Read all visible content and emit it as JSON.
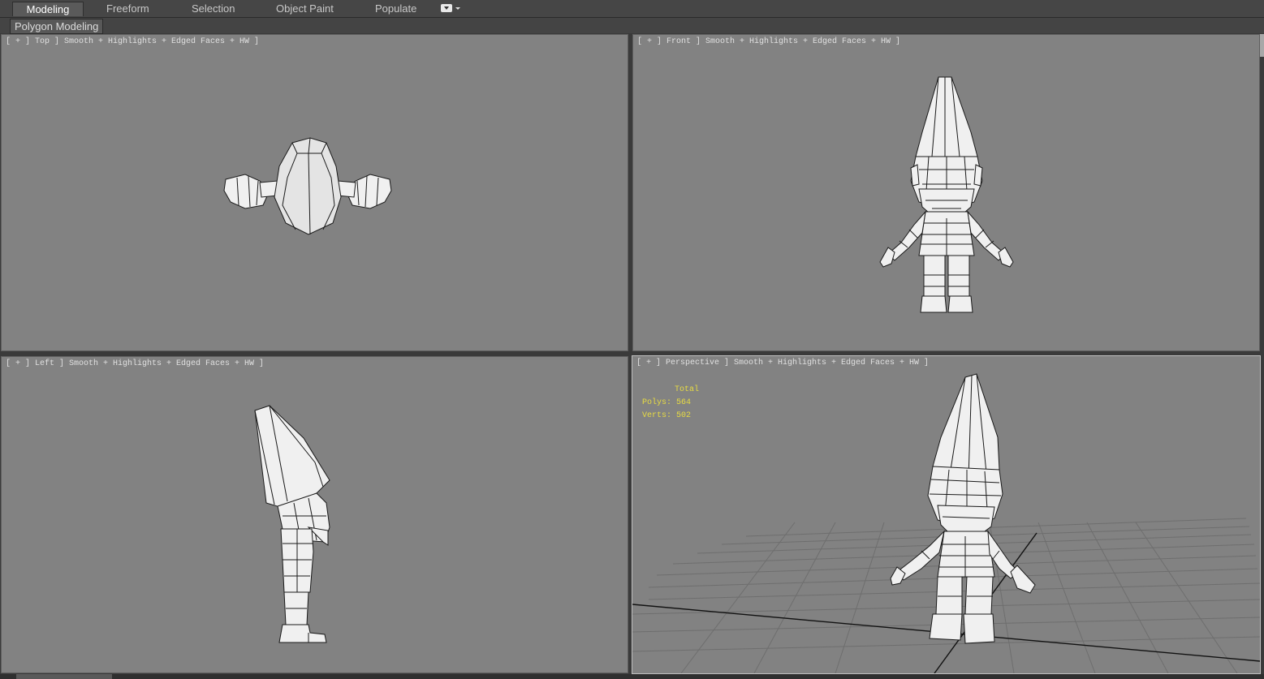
{
  "ribbon": {
    "tabs": [
      {
        "label": "Modeling",
        "active": true
      },
      {
        "label": "Freeform"
      },
      {
        "label": "Selection"
      },
      {
        "label": "Object Paint"
      },
      {
        "label": "Populate"
      }
    ],
    "menu_icon": "dropdown-icon",
    "panel_label": "Polygon Modeling"
  },
  "viewports": {
    "top": {
      "label": "[ + ] Top ] Smooth + Highlights + Edged Faces + HW ]"
    },
    "front": {
      "label": "[ + ] Front ] Smooth + Highlights + Edged Faces + HW ]"
    },
    "left": {
      "label": "[ + ] Left ] Smooth + Highlights + Edged Faces + HW ]"
    },
    "perspective": {
      "label": "[ + ] Perspective ] Smooth + Highlights + Edged Faces + HW ]"
    }
  },
  "stats": {
    "total_label": "Total",
    "polys_label": "Polys:",
    "polys_value": "564",
    "verts_label": "Verts:",
    "verts_value": "502"
  },
  "colors": {
    "viewport_bg": "#828282",
    "stats_text": "#e8dc42",
    "ui_bg": "#3a3a3a"
  }
}
